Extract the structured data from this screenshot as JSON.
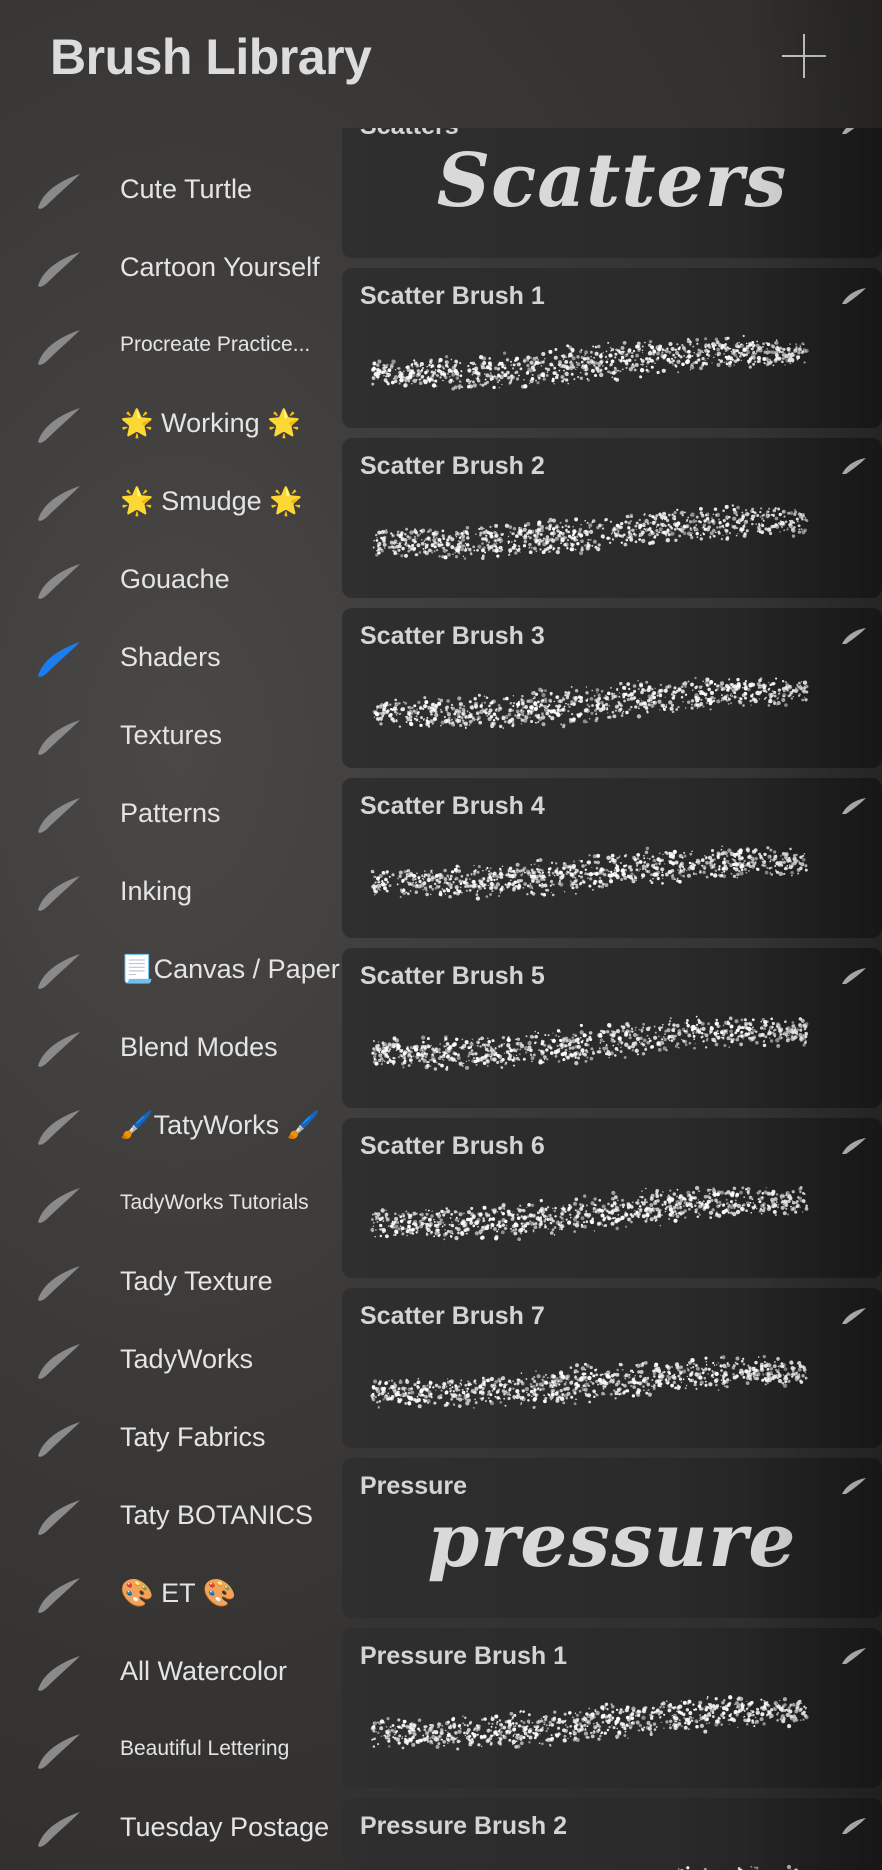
{
  "header": {
    "title": "Brush Library"
  },
  "sidebar": {
    "items": [
      {
        "label": "Cute Turtle",
        "small": false,
        "selected": false
      },
      {
        "label": "Cartoon Yourself",
        "small": false,
        "selected": false
      },
      {
        "label": "Procreate Practice...",
        "small": true,
        "selected": false
      },
      {
        "label": "🌟 Working 🌟",
        "small": false,
        "selected": false
      },
      {
        "label": "🌟 Smudge 🌟",
        "small": false,
        "selected": false
      },
      {
        "label": "Gouache",
        "small": false,
        "selected": false
      },
      {
        "label": "Shaders",
        "small": false,
        "selected": true
      },
      {
        "label": "Textures",
        "small": false,
        "selected": false
      },
      {
        "label": "Patterns",
        "small": false,
        "selected": false
      },
      {
        "label": "Inking",
        "small": false,
        "selected": false
      },
      {
        "label": "📃Canvas / Paper",
        "small": false,
        "selected": false
      },
      {
        "label": "Blend Modes",
        "small": false,
        "selected": false
      },
      {
        "label": "🖌️TatyWorks 🖌️",
        "small": false,
        "selected": false
      },
      {
        "label": "TadyWorks Tutorials",
        "small": true,
        "selected": false
      },
      {
        "label": "Tady Texture",
        "small": false,
        "selected": false
      },
      {
        "label": "TadyWorks",
        "small": false,
        "selected": false
      },
      {
        "label": "Taty Fabrics",
        "small": false,
        "selected": false
      },
      {
        "label": "Taty BOTANICS",
        "small": false,
        "selected": false
      },
      {
        "label": "🎨 ET 🎨",
        "small": false,
        "selected": false
      },
      {
        "label": "All Watercolor",
        "small": false,
        "selected": false
      },
      {
        "label": "Beautiful Lettering",
        "small": true,
        "selected": false
      },
      {
        "label": "Tuesday Postage",
        "small": false,
        "selected": false
      }
    ]
  },
  "brushes": [
    {
      "name": "Scatters",
      "preview": "script",
      "preview_text": "Scatters"
    },
    {
      "name": "Scatter Brush 1",
      "preview": "stroke"
    },
    {
      "name": "Scatter Brush 2",
      "preview": "stroke"
    },
    {
      "name": "Scatter Brush 3",
      "preview": "stroke"
    },
    {
      "name": "Scatter Brush 4",
      "preview": "stroke"
    },
    {
      "name": "Scatter Brush 5",
      "preview": "stroke"
    },
    {
      "name": "Scatter Brush 6",
      "preview": "stroke"
    },
    {
      "name": "Scatter Brush 7",
      "preview": "stroke"
    },
    {
      "name": "Pressure",
      "preview": "script",
      "preview_text": "pressure"
    },
    {
      "name": "Pressure Brush 1",
      "preview": "stroke"
    },
    {
      "name": "Pressure Brush 2",
      "preview": "stroke"
    }
  ],
  "colors": {
    "accent": "#1a7ef0",
    "icon_default": "#8a8a8a",
    "background": "#3a3836"
  },
  "icons": {
    "add": "plus-icon",
    "set": "brush-set-icon",
    "brush": "feather-icon"
  }
}
